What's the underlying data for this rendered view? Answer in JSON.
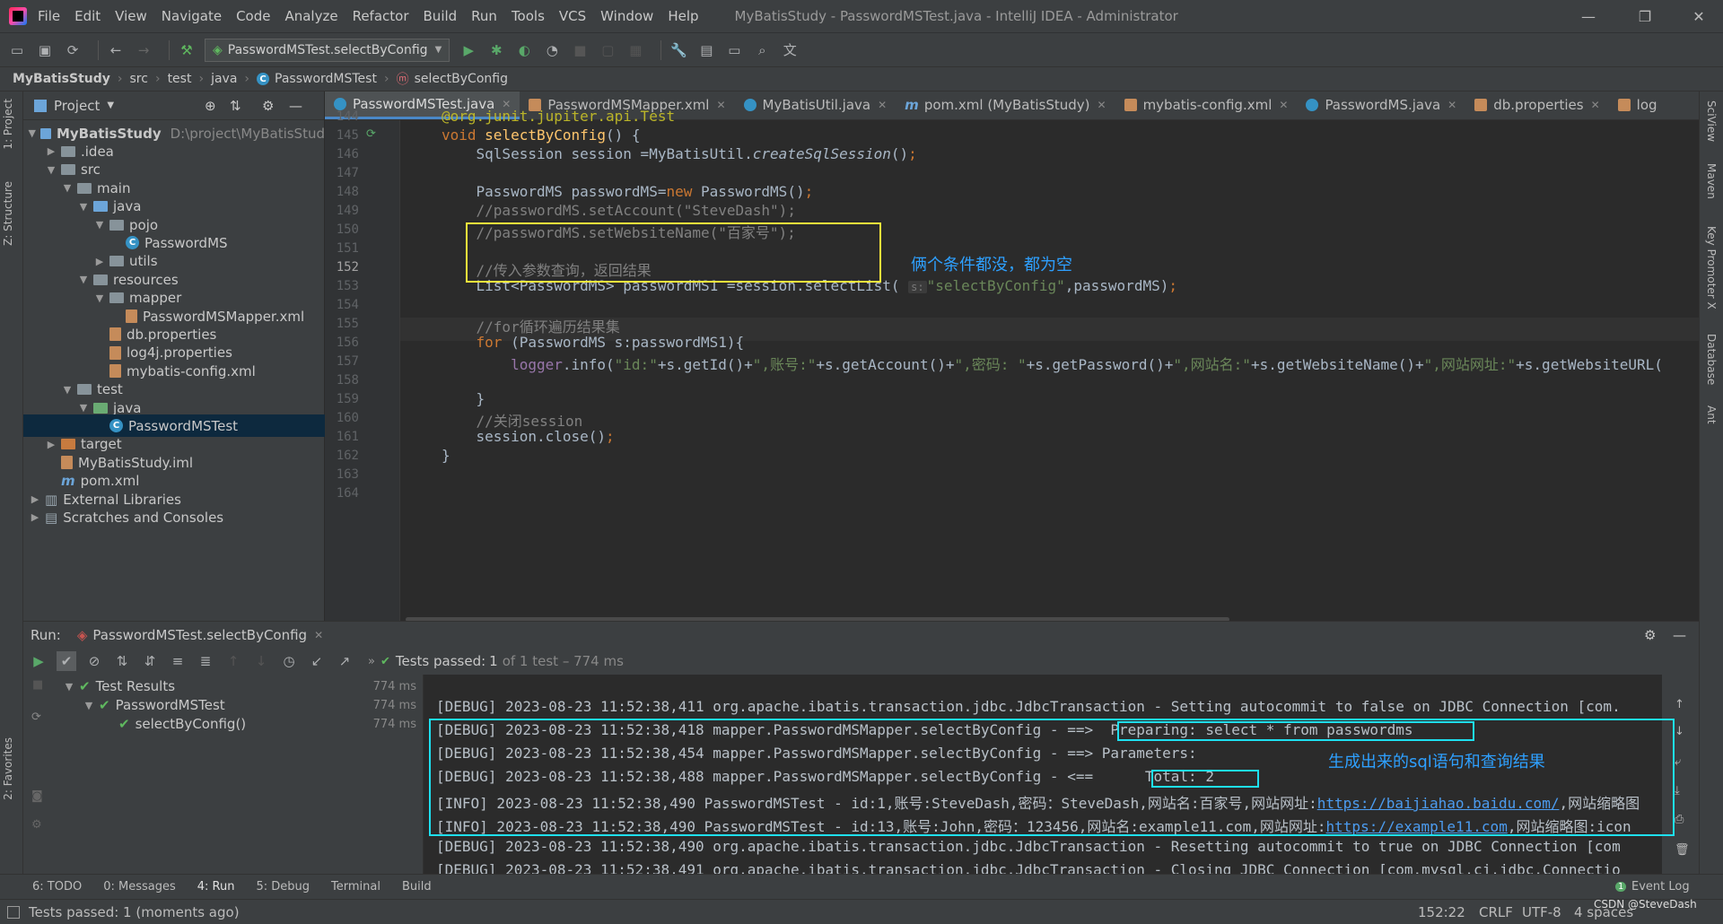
{
  "window": {
    "menu": [
      "File",
      "Edit",
      "View",
      "Navigate",
      "Code",
      "Analyze",
      "Refactor",
      "Build",
      "Run",
      "Tools",
      "VCS",
      "Window",
      "Help"
    ],
    "title": "MyBatisStudy - PasswordMSTest.java - IntelliJ IDEA - Administrator"
  },
  "toolbar": {
    "run_config": "PasswordMSTest.selectByConfig"
  },
  "breadcrumb": [
    "MyBatisStudy",
    "src",
    "test",
    "java",
    "PasswordMSTest",
    "selectByConfig"
  ],
  "left_strip": {
    "project_tab": "1: Project",
    "structure_tab": "Z: Structure",
    "favorites_tab": "2: Favorites"
  },
  "right_strip": [
    "SciView",
    "Maven",
    "Key Promoter X",
    "Database",
    "Ant"
  ],
  "project": {
    "header": "Project",
    "root_path": "D:\\project\\MyBatisStud",
    "tree": [
      {
        "label": "MyBatisStudy"
      },
      {
        "label": ".idea"
      },
      {
        "label": "src"
      },
      {
        "label": "main"
      },
      {
        "label": "java"
      },
      {
        "label": "pojo"
      },
      {
        "label": "PasswordMS"
      },
      {
        "label": "utils"
      },
      {
        "label": "resources"
      },
      {
        "label": "mapper"
      },
      {
        "label": "PasswordMSMapper.xml"
      },
      {
        "label": "db.properties"
      },
      {
        "label": "log4j.properties"
      },
      {
        "label": "mybatis-config.xml"
      },
      {
        "label": "test"
      },
      {
        "label": "java"
      },
      {
        "label": "PasswordMSTest"
      },
      {
        "label": "target"
      },
      {
        "label": "MyBatisStudy.iml"
      },
      {
        "label": "pom.xml"
      },
      {
        "label": "External Libraries"
      },
      {
        "label": "Scratches and Consoles"
      }
    ]
  },
  "editor_tabs": [
    {
      "label": "PasswordMSTest.java"
    },
    {
      "label": "PasswordMSMapper.xml"
    },
    {
      "label": "MyBatisUtil.java"
    },
    {
      "label": "pom.xml (MyBatisStudy)"
    },
    {
      "label": "mybatis-config.xml"
    },
    {
      "label": "PasswordMS.java"
    },
    {
      "label": "db.properties"
    },
    {
      "label": "log"
    }
  ],
  "editor": {
    "line_numbers": [
      "144",
      "145",
      "146",
      "147",
      "148",
      "149",
      "150",
      "151",
      "152",
      "153",
      "154",
      "155",
      "156",
      "157",
      "158",
      "159",
      "160",
      "161",
      "162",
      "163",
      "164"
    ],
    "annotation_note": "俩个条件都没，都为空",
    "param_hint": "s:"
  },
  "run": {
    "label": "Run:",
    "tab": "PasswordMSTest.selectByConfig",
    "tests_passed": "Tests passed:",
    "tests_count": "1",
    "tests_detail": "of 1 test – 774 ms",
    "tree": [
      {
        "label": "Test Results",
        "time": "774 ms"
      },
      {
        "label": "PasswordMSTest",
        "time": "774 ms"
      },
      {
        "label": "selectByConfig()",
        "time": "774 ms"
      }
    ],
    "console": [
      "[DEBUG] 2023-08-23 11:52:38,411 org.apache.ibatis.transaction.jdbc.JdbcTransaction - Setting autocommit to false on JDBC Connection [com.",
      "[DEBUG] 2023-08-23 11:52:38,418 mapper.PasswordMSMapper.selectByConfig - ==>  Preparing: select * from passwordms",
      "[DEBUG] 2023-08-23 11:52:38,454 mapper.PasswordMSMapper.selectByConfig - ==> Parameters: ",
      "[DEBUG] 2023-08-23 11:52:38,488 mapper.PasswordMSMapper.selectByConfig - <==      Total: 2",
      "[INFO] 2023-08-23 11:52:38,490 PasswordMSTest - id:1,账号:SteveDash,密码：SteveDash,网站名:百家号,网站网址:",
      "[INFO] 2023-08-23 11:52:38,490 PasswordMSTest - id:13,账号:John,密码：123456,网站名:example11.com,网站网址:",
      "[DEBUG] 2023-08-23 11:52:38,490 org.apache.ibatis.transaction.jdbc.JdbcTransaction - Resetting autocommit to true on JDBC Connection [com",
      "[DEBUG] 2023-08-23 11:52:38,491 org.apache.ibatis.transaction.jdbc.JdbcTransaction - Closing JDBC Connection [com.mysql.cj.jdbc.Connectio"
    ],
    "link1": "https://baijiahao.baidu.com/",
    "link1_tail": ",网站缩略图",
    "link2": "https://example11.com",
    "link2_tail": ",网站缩略图:icon",
    "annotation_note": "生成出来的sql语句和查询结果"
  },
  "bottom_tabs": [
    "6: TODO",
    "0: Messages",
    "4: Run",
    "5: Debug",
    "Terminal",
    "Build"
  ],
  "event_log": "Event Log",
  "event_count": "1",
  "status": {
    "message": "Tests passed: 1 (moments ago)",
    "position": "152:22",
    "line_sep": "CRLF",
    "encoding": "UTF-8",
    "indent": "4 spaces",
    "watermark": "CSDN @SteveDash"
  },
  "colors": {
    "highlight_yellow": "#ffeb3b",
    "highlight_cyan": "#1ee0f0",
    "note_blue": "#2ea0ff"
  }
}
